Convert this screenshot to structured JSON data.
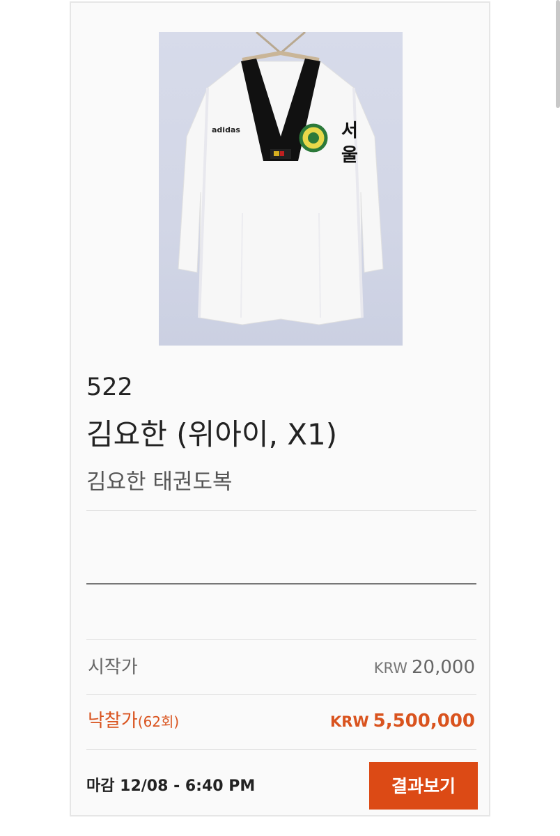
{
  "lot": {
    "number": "522",
    "title": "김요한 (위아이, X1)",
    "subtitle": "김요한 태권도복",
    "photo_alt": "taekwondo-uniform-photo",
    "uniform_text": {
      "brand": "adidas",
      "sleeve": "서울"
    }
  },
  "pricing": {
    "start_label": "시작가",
    "start_currency": "KRW",
    "start_amount": "20,000",
    "sold_label": "낙찰가",
    "sold_bid_count": "(62회)",
    "sold_currency": "KRW",
    "sold_amount": "5,500,000"
  },
  "footer": {
    "deadline": "마감 12/08 - 6:40 PM",
    "result_button": "결과보기"
  },
  "colors": {
    "accent": "#dc4a15",
    "sold_text": "#d9531e"
  }
}
